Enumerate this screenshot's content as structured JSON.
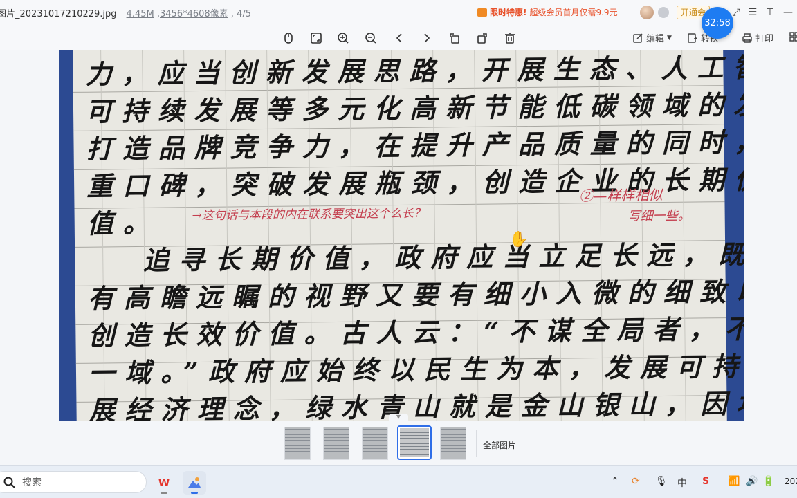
{
  "window": {
    "filename": "图片_20231017210229.jpg",
    "filesize": "4.45M",
    "resolution": "3456*4608像素",
    "page_index": "4/5"
  },
  "promo": {
    "hot_label": "限时特惠!",
    "text": "超级会员首月仅需9.9元",
    "open_button": "开通会"
  },
  "timer": "32:58",
  "toolbar": {
    "edit_label": "编辑",
    "convert_label": "转换",
    "print_label": "打印"
  },
  "document": {
    "lines": [
      "力，应当创新发展思路，开展生态、人工智能",
      "可持续发展等多元化高新节能低碳领域的发展",
      "打造品牌竞争力，在提升产品质量的同时，注",
      "重口碑，突破发展瓶颈，创造企业的长期价",
      "值。",
      "追寻长期价值，政府应当立足长远，既要",
      "有高瞻远瞩的视野又要有细小入微的细致以此",
      "创造长效价值。古人云：“不谋全局者，不足谋",
      "一域。”政府应始终以民生为本，发展可持续发",
      "展经济理念，绿水青山就是金山银山，因地制"
    ],
    "annotations": {
      "note_right_1": "②—样样相似",
      "note_right_2": "写细一些。",
      "note_middle": "→这句话与本段的内在联系要突出这个么长？"
    }
  },
  "thumbnails": {
    "count": 5,
    "selected": 4,
    "all_label": "全部图片"
  },
  "taskbar": {
    "search_placeholder": "搜索",
    "clock": "202"
  },
  "colors": {
    "accent": "#1e7cf2",
    "promo": "#e8512a",
    "annotation_red": "#c43f4f",
    "paper_blue": "#2c4a92"
  }
}
